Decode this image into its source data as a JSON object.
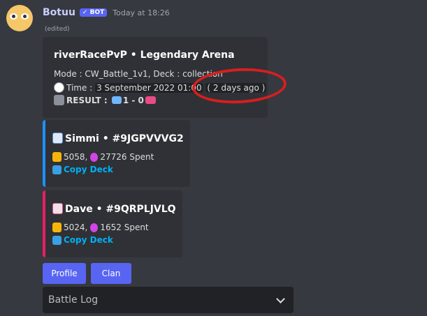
{
  "message": {
    "username": "Botuu",
    "bot_badge": "✓ BOT",
    "timestamp": "Today at 18:26",
    "edited": "(edited)"
  },
  "embed_main": {
    "title": "riverRacePvP • Legendary Arena",
    "mode_line": "Mode : CW_Battle_1v1, Deck : collection",
    "time_prefix": "Time :",
    "time_value": "3 September 2022 01:00",
    "time_relative": "( 2 days ago )",
    "result_label": "RESULT :",
    "result_score": "1 - 0"
  },
  "embed_simmi": {
    "title": "Simmi • #9JGPVVVG2",
    "trophies": "5058,",
    "elixir": "27726 Spent",
    "copy_deck": "Copy Deck"
  },
  "embed_dave": {
    "title": "Dave • #9QRPLJVLQ",
    "trophies": "5024,",
    "elixir": "1652 Spent",
    "copy_deck": "Copy Deck"
  },
  "buttons": {
    "profile": "Profile",
    "clan": "Clan"
  },
  "select": {
    "placeholder": "Battle Log"
  },
  "colors": {
    "background": "#36393f",
    "embed": "#2f3136",
    "accent_blue": "#1e90ff",
    "accent_pink": "#e91e63",
    "blurple": "#5865f2",
    "link": "#00b0f4",
    "annotation_red": "#d81e1e"
  }
}
